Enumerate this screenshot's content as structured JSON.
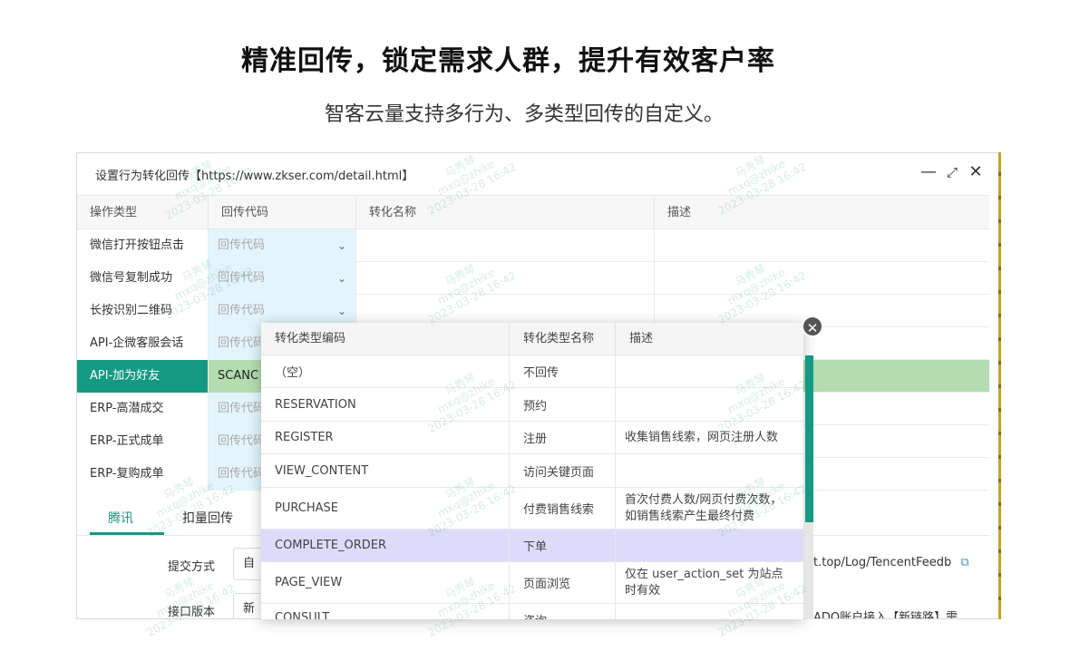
{
  "headline": "精准回传，锁定需求人群，提升有效客户率",
  "subline": "智客云量支持多行为、多类型回传的自定义。",
  "window": {
    "title": "设置行为转化回传【https://www.zkser.com/detail.html】",
    "controls": {
      "minimize": "—",
      "maximize": "⤢",
      "close": "✕"
    }
  },
  "grid": {
    "columns": [
      "操作类型",
      "回传代码",
      "转化名称",
      "描述"
    ],
    "rows": [
      {
        "type": "微信打开按钮点击",
        "code": "回传代码"
      },
      {
        "type": "微信号复制成功",
        "code": "回传代码"
      },
      {
        "type": "长按识别二维码",
        "code": "回传代码"
      },
      {
        "type": "API-企微客服会话",
        "code": "回传代码"
      },
      {
        "type": "API-加为好友",
        "code": "SCANC"
      },
      {
        "type": "ERP-高潜成交",
        "code": "回传代码"
      },
      {
        "type": "ERP-正式成单",
        "code": "回传代码"
      },
      {
        "type": "ERP-复购成单",
        "code": "回传代码"
      }
    ]
  },
  "tabs": [
    "腾讯",
    "扣量回传"
  ],
  "form": {
    "submit_label": "提交方式",
    "submit_value": "自",
    "api_label": "接口版本",
    "api_value": "新",
    "url_value": "t.top/Log/TencentFeedb",
    "note_value": "ADQ账户接入【新链路】需"
  },
  "popup": {
    "columns": [
      "转化类型编码",
      "转化类型名称",
      "描述"
    ],
    "rows": [
      {
        "code": "（空）",
        "name": "不回传",
        "desc": ""
      },
      {
        "code": "RESERVATION",
        "name": "预约",
        "desc": ""
      },
      {
        "code": "REGISTER",
        "name": "注册",
        "desc": "收集销售线索，网页注册人数"
      },
      {
        "code": "VIEW_CONTENT",
        "name": "访问关键页面",
        "desc": ""
      },
      {
        "code": "PURCHASE",
        "name": "付费销售线索",
        "desc": "首次付费人数/网页付费次数，如销售线索产生最终付费"
      },
      {
        "code": "COMPLETE_ORDER",
        "name": "下单",
        "desc": ""
      },
      {
        "code": "PAGE_VIEW",
        "name": "页面浏览",
        "desc": "仅在 user_action_set 为站点时有效"
      },
      {
        "code": "CONSULT",
        "name": "咨询",
        "desc": ""
      }
    ],
    "close": "✕"
  },
  "watermark": {
    "name": "马秀琴",
    "account": "mxq@zhike",
    "time": "2023-03-28 16:42"
  }
}
